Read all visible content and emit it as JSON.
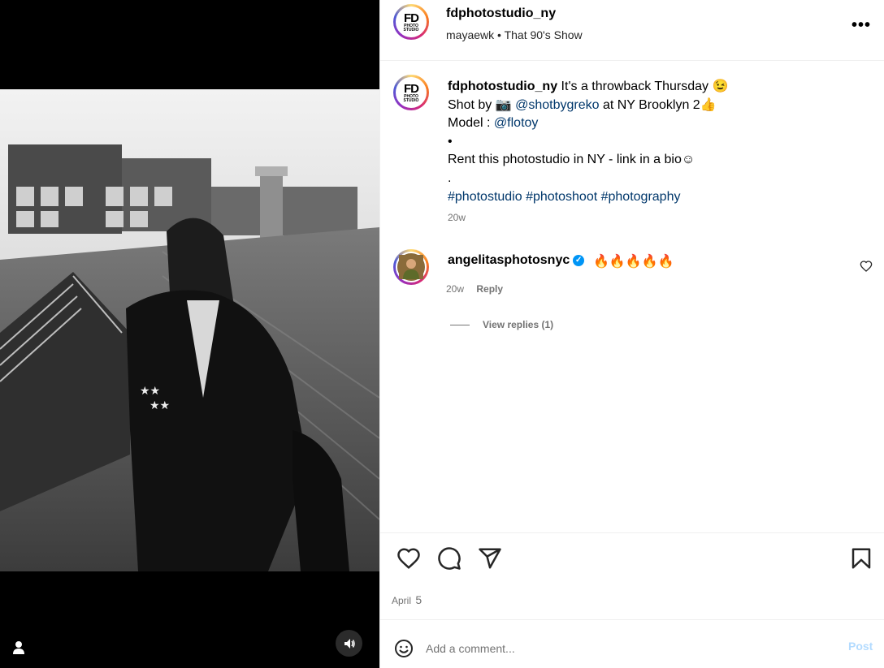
{
  "header": {
    "username": "fdphotostudio_ny",
    "subtitle_user": "mayaewk",
    "subtitle_sep": "•",
    "subtitle_audio": "That 90's Show",
    "more_label": "•••",
    "avatar_text_big": "FD",
    "avatar_text_small": "PHOTO STUDIO"
  },
  "caption": {
    "username": "fdphotostudio_ny",
    "line1": "It's a throwback Thursday 😉",
    "line2_prefix": "Shot by 📷",
    "line2_mention": "@shotbygreko",
    "line2_suffix": "at NY Brooklyn 2👍",
    "line3_prefix": "Model :",
    "line3_mention": "@flotoy",
    "line4": "•",
    "line5": "Rent this photostudio in NY - link in a bio☺",
    "line6": ".",
    "hashtags": "#photostudio #photoshoot #photography",
    "time": "20w"
  },
  "comment": {
    "username": "angelitasphotosnyc",
    "verified_mark": "✓",
    "text": "🔥🔥🔥🔥🔥",
    "time": "20w",
    "reply_label": "Reply",
    "view_replies": "View replies (1)"
  },
  "footer": {
    "date_month": "April",
    "date_day": "5",
    "placeholder": "Add a comment...",
    "post_label": "Post"
  },
  "icons": {
    "like": "heart-icon",
    "comment": "comment-icon",
    "share": "send-icon",
    "save": "bookmark-icon",
    "emoji": "smiley-icon",
    "audio": "speaker-icon",
    "tag": "person-tag-icon",
    "comment_like": "heart-icon"
  },
  "colors": {
    "link": "#00376b",
    "meta": "#737373",
    "verified": "#0095f6",
    "post_disabled": "#b3dbff"
  }
}
